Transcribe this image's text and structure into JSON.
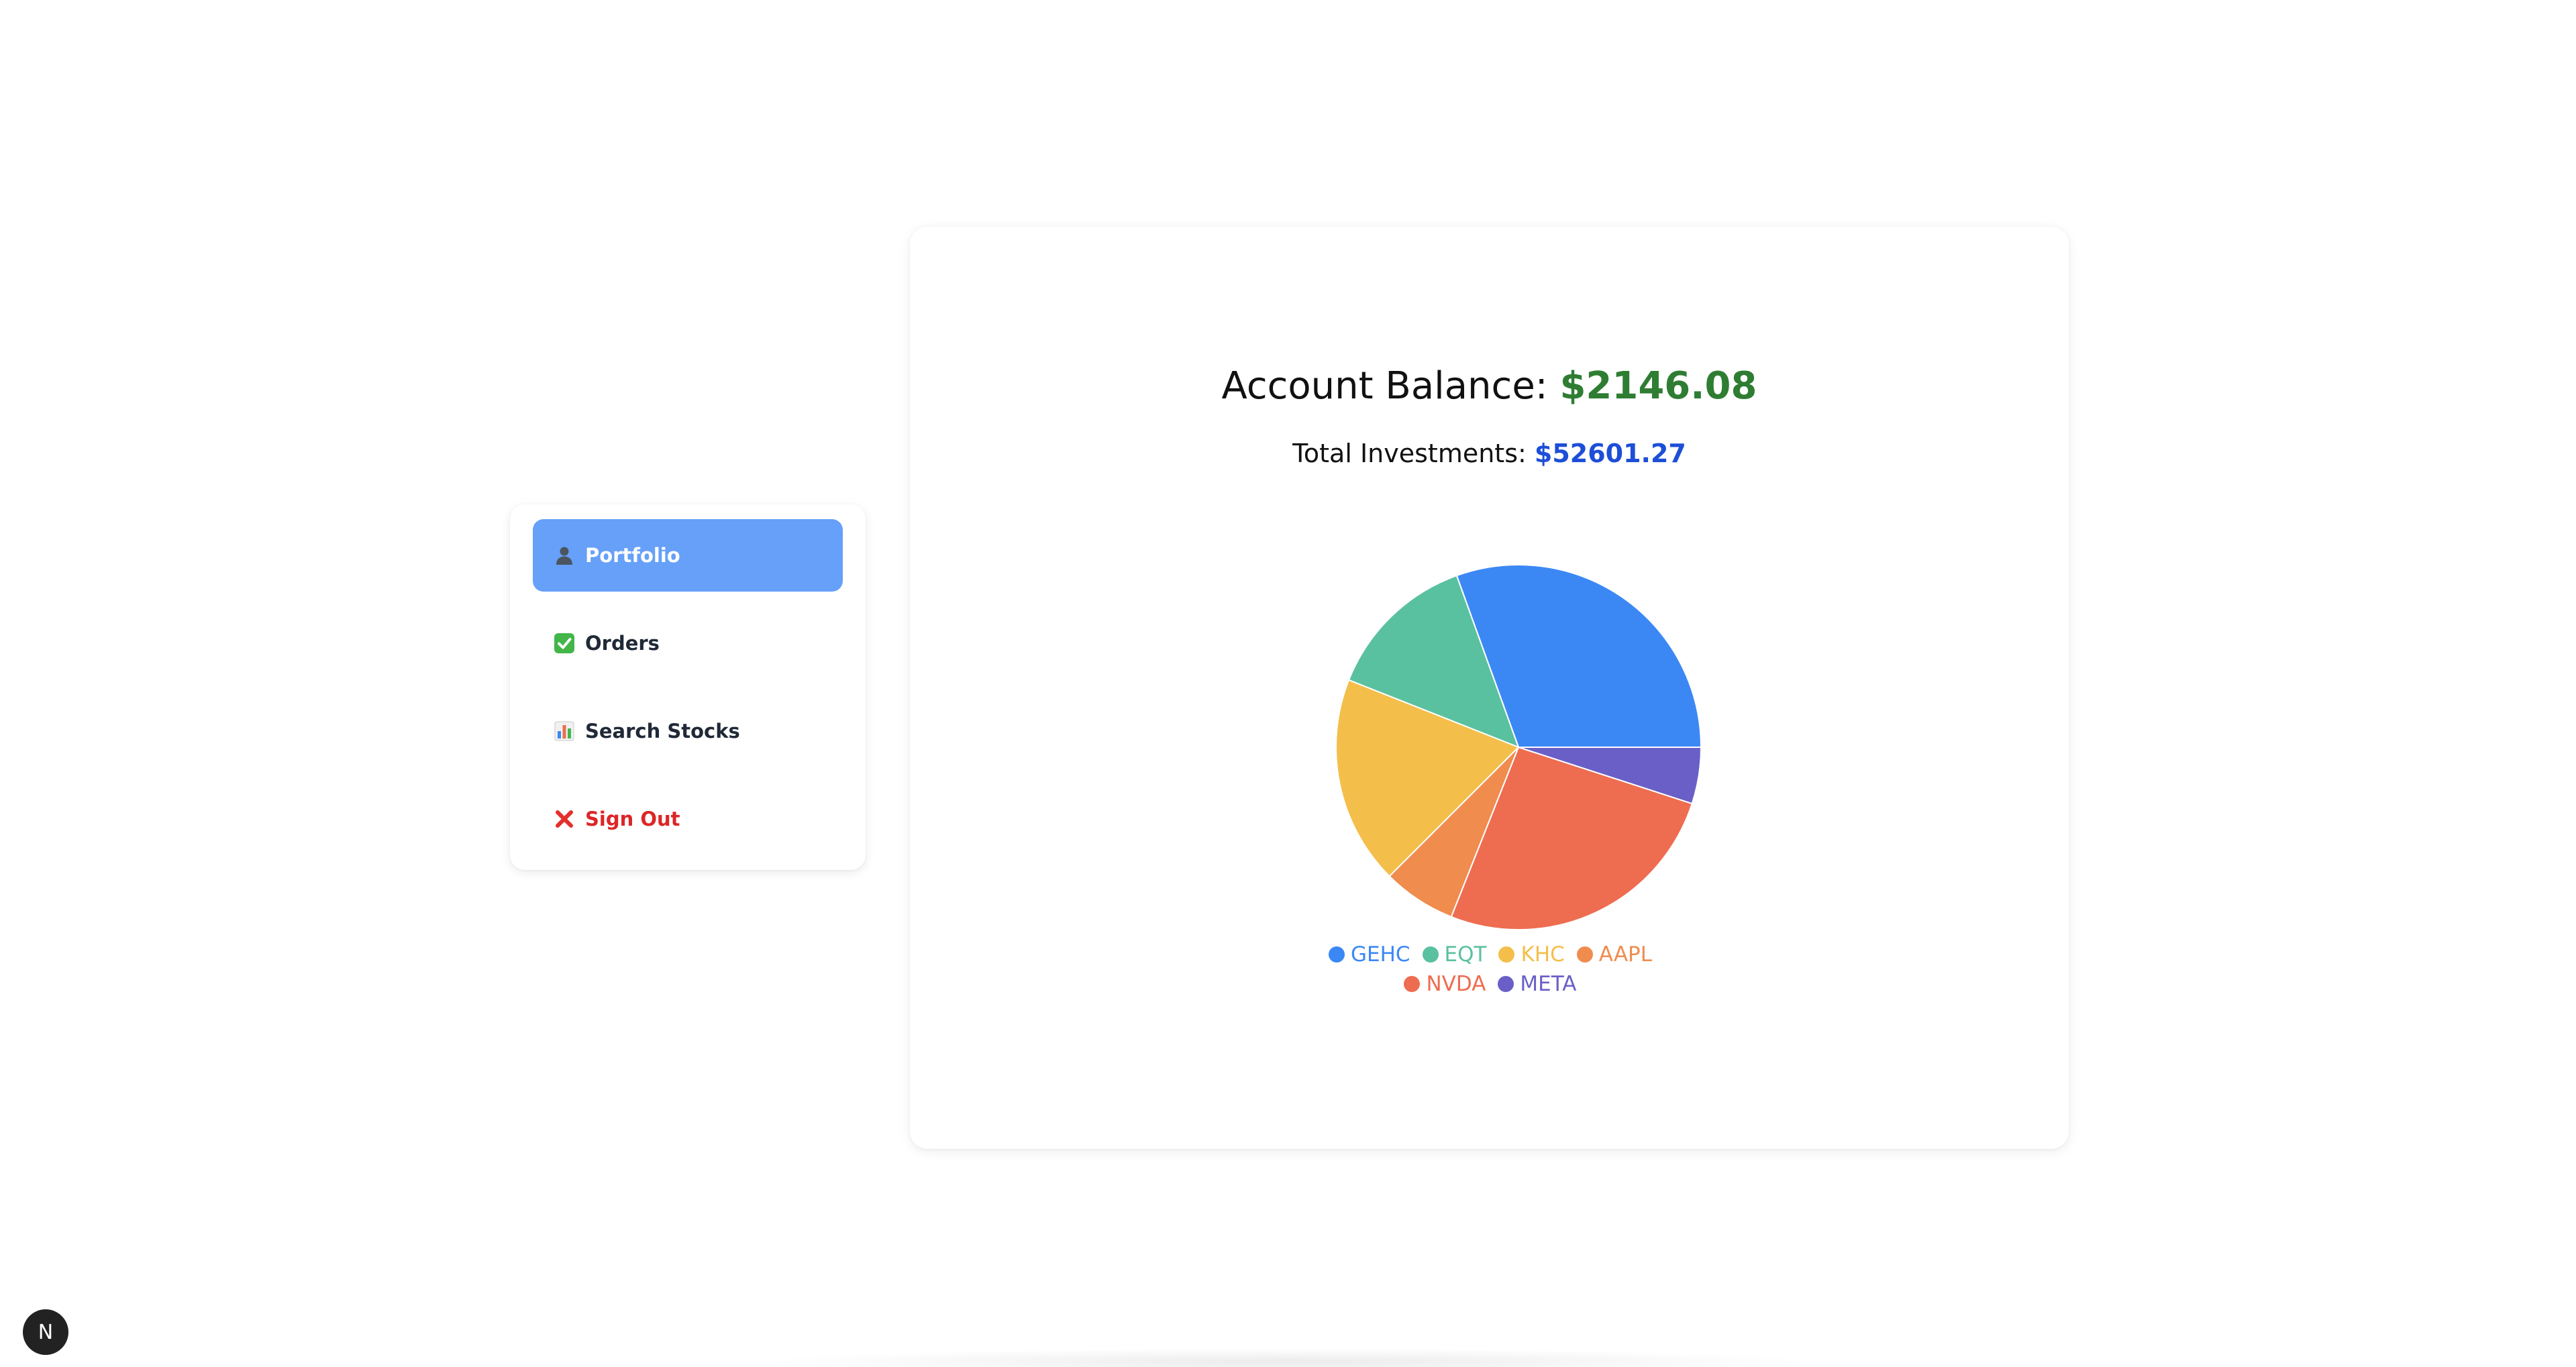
{
  "sidebar": {
    "items": [
      {
        "label": "Portfolio",
        "icon": "user-silhouette-icon",
        "active": true
      },
      {
        "label": "Orders",
        "icon": "check-mark-icon"
      },
      {
        "label": "Search Stocks",
        "icon": "bar-chart-icon"
      },
      {
        "label": "Sign Out",
        "icon": "cross-mark-icon",
        "danger": true
      }
    ]
  },
  "summary": {
    "balance_label": "Account Balance: ",
    "balance_value": "$2146.08",
    "investments_label": "Total Investments: ",
    "investments_value": "$52601.27"
  },
  "colors": {
    "active_nav": "#66a0f8",
    "balance": "#2e7d32",
    "investments": "#1d4ed8",
    "sign_out": "#dc2626"
  },
  "chart_data": {
    "type": "pie",
    "categories": [
      "GEHC",
      "EQT",
      "KHC",
      "AAPL",
      "NVDA",
      "META"
    ],
    "values": [
      30.5,
      13.5,
      18.5,
      6.5,
      26,
      5
    ],
    "colors": [
      "#3b88f5",
      "#5ac1a0",
      "#f4be4a",
      "#ef8c4e",
      "#ee6c50",
      "#695fc7"
    ],
    "legend": "bottom",
    "start_angle_deg": 0,
    "direction": "counterclockwise"
  },
  "badge": {
    "label": "N"
  }
}
